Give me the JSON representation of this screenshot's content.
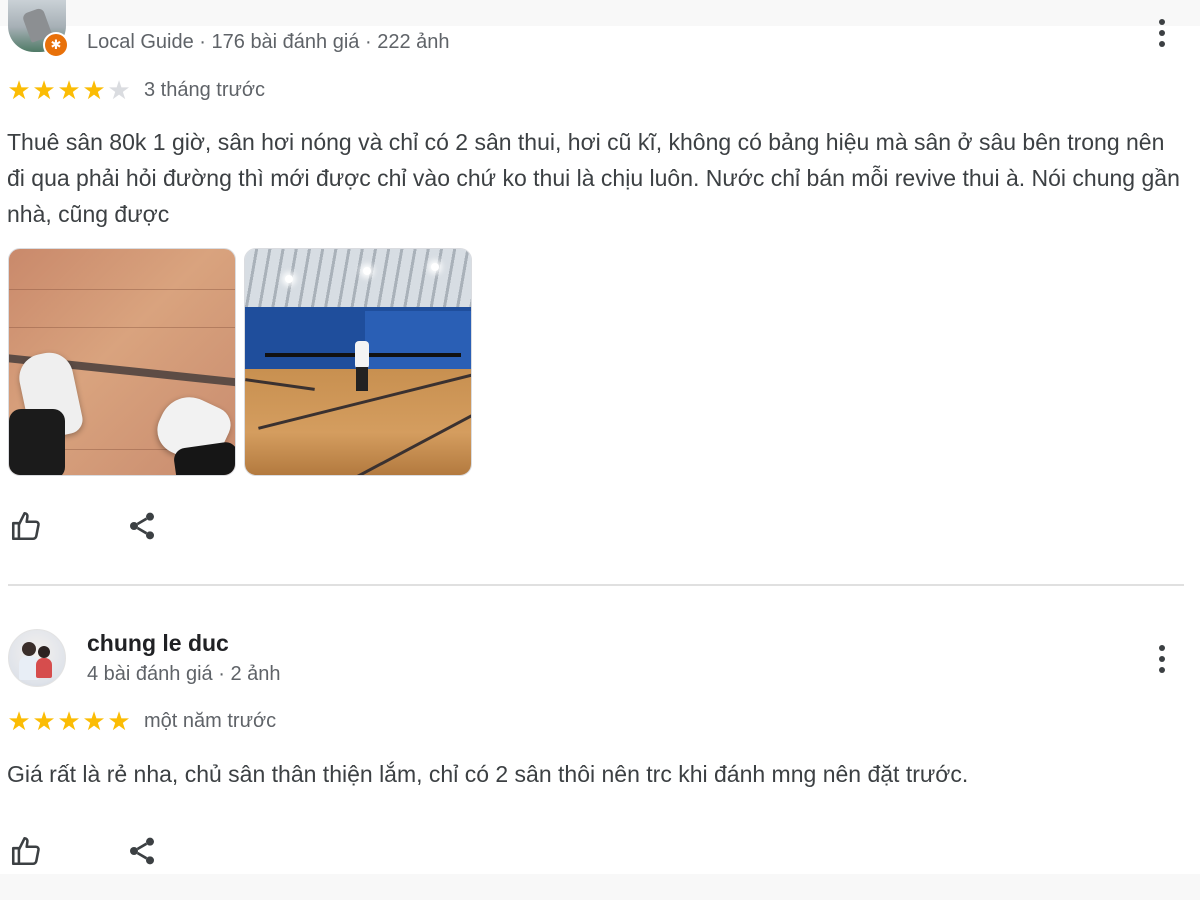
{
  "reviews": [
    {
      "author_name": "",
      "meta": "Local Guide · 176 bài đánh giá · 222 ảnh",
      "rating": 4,
      "max_rating": 5,
      "time": "3 tháng trước",
      "text": "Thuê sân 80k 1 giờ, sân hơi nóng và chỉ có 2 sân thui, hơi cũ kĩ, không có bảng hiệu mà sân ở sâu bên trong nên đi qua phải hỏi đường thì mới được chỉ vào chứ ko thui là chịu luôn. Nước chỉ bán mỗi revive thui à. Nói chung gần nhà, cũng được",
      "photos": [
        "sneakers-on-wooden-court-photo",
        "badminton-hall-photo"
      ],
      "icons": {
        "like": "thumb-up-icon",
        "share": "share-icon",
        "menu": "more-vert-icon",
        "badge": "local-guide-badge-icon"
      }
    },
    {
      "author_name": "chung le duc",
      "meta": "4 bài đánh giá · 2 ảnh",
      "rating": 5,
      "max_rating": 5,
      "time": "một năm trước",
      "text": "Giá rất là rẻ nha, chủ sân thân thiện lắm, chỉ có 2 sân thôi nên trc khi đánh mng nên đặt trước.",
      "icons": {
        "like": "thumb-up-icon",
        "share": "share-icon",
        "menu": "more-vert-icon"
      }
    }
  ],
  "colors": {
    "star_full": "#fbbc04",
    "star_empty": "#dadce0",
    "text": "#3c4043",
    "meta": "#5f6368"
  }
}
